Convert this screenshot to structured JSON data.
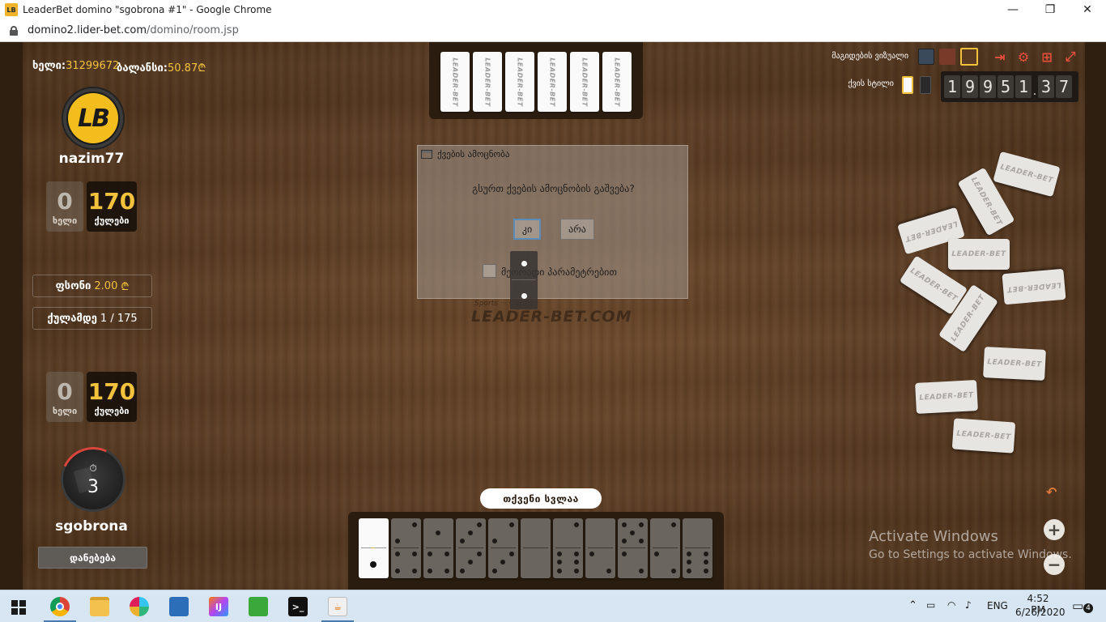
{
  "window": {
    "title": "LeaderBet domino \"sgobrona #1\" - Google Chrome",
    "favicon": "LB",
    "minimize_icon": "—",
    "restore_icon": "❐",
    "close_icon": "✕"
  },
  "address": {
    "host": "domino2.lider-bet.com",
    "path": "/domino/room.jsp"
  },
  "header_info": {
    "hand_label": "ხელი:",
    "hand_value": "31299672",
    "balance_label": "ბალანსი:",
    "balance_value": "50.87",
    "currency": "₾"
  },
  "opponent": {
    "name": "nazim77",
    "logo": "LB",
    "hands_value": "0",
    "hands_label": "ხელი",
    "points_value": "170",
    "points_label": "ქულები"
  },
  "match": {
    "price_label": "ფსონი",
    "price_value": "2.00",
    "currency": "₾",
    "to_points_label": "ქულამდე",
    "to_points_value": "1 / 175"
  },
  "player": {
    "name": "sgobrona",
    "hands_value": "0",
    "hands_label": "ხელი",
    "points_value": "170",
    "points_label": "ქულები",
    "timer_icon": "⏱",
    "timer_value": "3",
    "leave_button": "დანებება"
  },
  "controls": {
    "tables_label": "მაგიდების ვიზუალი",
    "tile_label": "ქვის სტილი",
    "score_digits": [
      "1",
      "9",
      "9",
      "5",
      "1",
      "3",
      "7"
    ],
    "score_separator": ".",
    "exit_icon": "⇥",
    "settings_icon": "⚙",
    "grid_icon": "⊞",
    "fullscreen_icon": "⤢",
    "undo_icon": "↶",
    "zoom_in": "+",
    "zoom_out": "−"
  },
  "tile_brand": "LEADER-BET",
  "watermark": "LEADER-BET.COM",
  "watermark_small": "Sports ··· Casino",
  "dialog": {
    "title": "ქვების ამოცნობა",
    "question": "გსურთ ქვების ამოცნობის გაშვება?",
    "yes": "კი",
    "no": "არა",
    "checkbox_label": "მეორადი პარამეტრებით"
  },
  "turn_label": "თქვენი სვლაა",
  "windows_notice": {
    "line1": "Activate Windows",
    "line2": "Go to Settings to activate Windows."
  },
  "taskbar": {
    "lang": "ENG",
    "time": "4:52 PM",
    "date": "6/26/2020",
    "notifications": "4"
  },
  "colors": {
    "accent_gold": "#f3c23c",
    "felt_wood": "#5a3b22",
    "danger_red": "#e94e3d"
  }
}
